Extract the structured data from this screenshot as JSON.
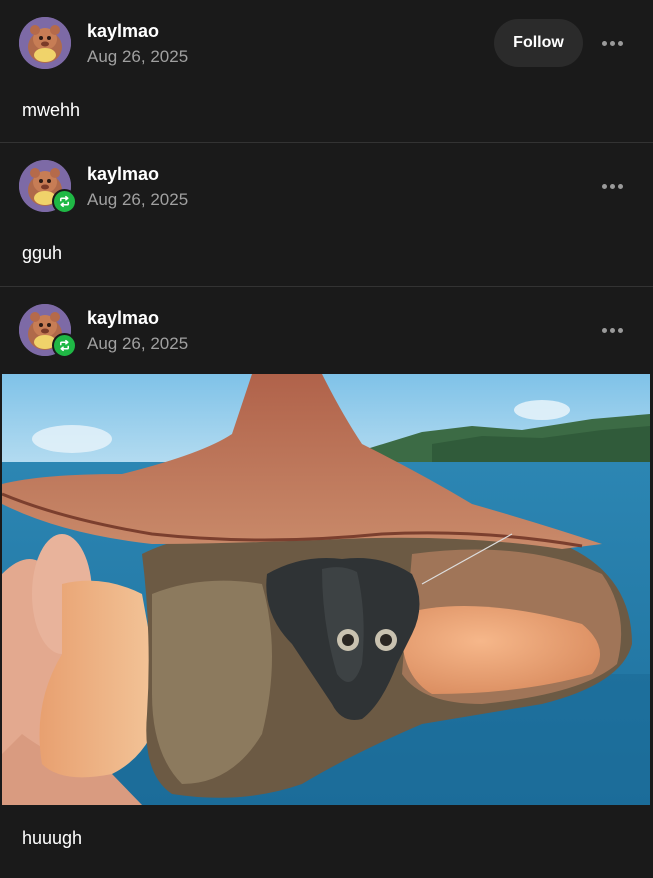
{
  "posts": [
    {
      "username": "kaylmao",
      "date": "Aug 26, 2025",
      "follow_label": "Follow",
      "body": "mwehh",
      "reblogged": false
    },
    {
      "username": "kaylmao",
      "date": "Aug 26, 2025",
      "body": "gguh",
      "reblogged": true
    },
    {
      "username": "kaylmao",
      "date": "Aug 26, 2025",
      "body": "huuugh",
      "reblogged": true,
      "image_alt": ""
    }
  ],
  "icons": {
    "more": "more-horizontal-icon",
    "reblog": "reblog-icon",
    "avatar": "avatar"
  },
  "colors": {
    "background": "#1a1a1a",
    "reblog_badge": "#1fb845",
    "follow_button_bg": "#2b2b2b",
    "secondary_text": "#a0a0a0"
  }
}
